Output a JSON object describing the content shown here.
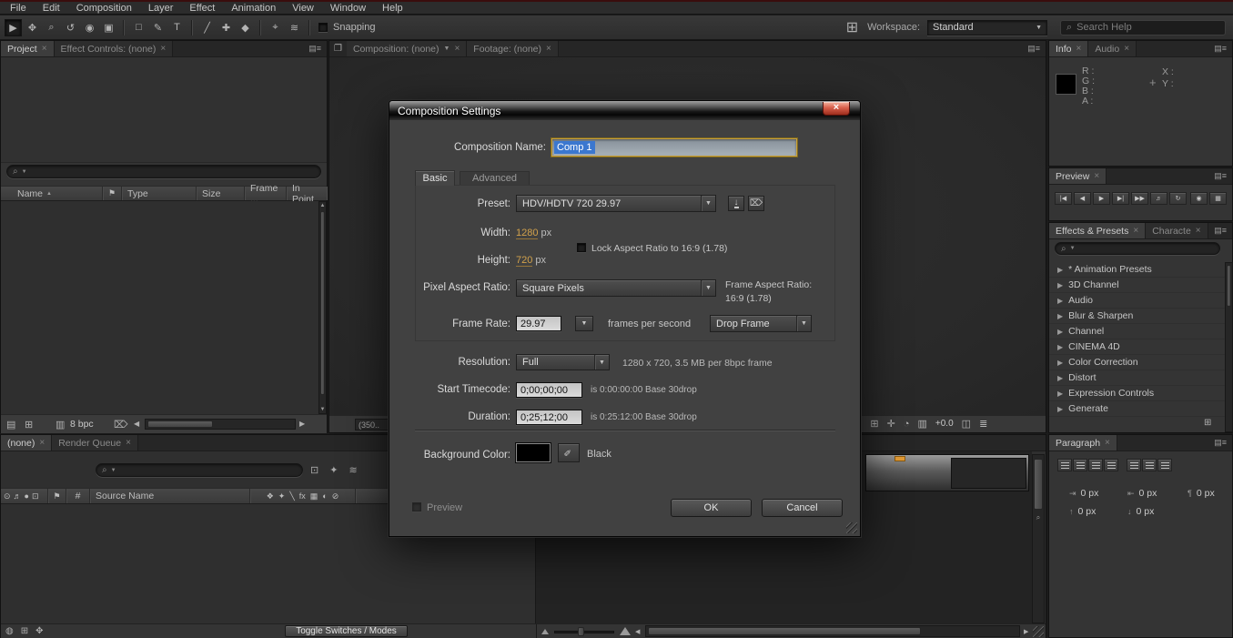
{
  "menubar": {
    "items": [
      "File",
      "Edit",
      "Composition",
      "Layer",
      "Effect",
      "Animation",
      "View",
      "Window",
      "Help"
    ]
  },
  "toolbar": {
    "snapping_label": "Snapping",
    "workspace_label": "Workspace:",
    "workspace_value": "Standard",
    "search_placeholder": "Search Help"
  },
  "project_panel": {
    "tab_project": "Project",
    "tab_effect_controls": "Effect Controls: (none)",
    "columns": [
      "Name",
      "Type",
      "Size",
      "Frame ...",
      "In Point"
    ],
    "bpc": "8 bpc"
  },
  "comp_panel": {
    "tab_composition": "Composition: (none)",
    "tab_footage": "Footage: (none)",
    "magnification": "(350..",
    "offset_value": "+0.0"
  },
  "info_panel": {
    "tab_info": "Info",
    "tab_audio": "Audio",
    "channel_labels": [
      "R :",
      "G :",
      "B :",
      "A :"
    ],
    "coord_labels": [
      "X :",
      "Y :"
    ]
  },
  "preview_panel": {
    "tab_preview": "Preview"
  },
  "effects_panel": {
    "tab_effects": "Effects & Presets",
    "tab_character": "Characte",
    "items": [
      "* Animation Presets",
      "3D Channel",
      "Audio",
      "Blur & Sharpen",
      "Channel",
      "CINEMA 4D",
      "Color Correction",
      "Distort",
      "Expression Controls",
      "Generate"
    ]
  },
  "paragraph_panel": {
    "tab_paragraph": "Paragraph",
    "values": [
      "0 px",
      "0 px",
      "0 px",
      "0 px",
      "0 px"
    ]
  },
  "timeline_panel": {
    "tab_none": "(none)",
    "tab_render_queue": "Render Queue",
    "column_hash": "#",
    "column_source_name": "Source Name",
    "toggle_button": "Toggle Switches / Modes"
  },
  "dialog": {
    "title": "Composition Settings",
    "name_label": "Composition Name:",
    "name_value": "Comp 1",
    "tab_basic": "Basic",
    "tab_advanced": "Advanced",
    "preset_label": "Preset:",
    "preset_value": "HDV/HDTV 720 29.97",
    "width_label": "Width:",
    "width_value": "1280",
    "width_unit": "px",
    "lock_aspect_label": "Lock Aspect Ratio to 16:9 (1.78)",
    "height_label": "Height:",
    "height_value": "720",
    "height_unit": "px",
    "par_label": "Pixel Aspect Ratio:",
    "par_value": "Square Pixels",
    "far_label": "Frame Aspect Ratio:",
    "far_value": "16:9 (1.78)",
    "frame_rate_label": "Frame Rate:",
    "frame_rate_value": "29.97",
    "fps_suffix": "frames per second",
    "drop_frame_value": "Drop Frame",
    "resolution_label": "Resolution:",
    "resolution_value": "Full",
    "resolution_info": "1280 x 720, 3.5 MB per 8bpc frame",
    "start_label": "Start Timecode:",
    "start_value": "0;00;00;00",
    "start_info": "is 0:00:00:00  Base 30drop",
    "duration_label": "Duration:",
    "duration_value": "0;25;12;00",
    "duration_info": "is 0:25:12:00  Base 30drop",
    "bg_label": "Background Color:",
    "bg_name": "Black",
    "preview_label": "Preview",
    "ok": "OK",
    "cancel": "Cancel"
  },
  "colors": {
    "hot_text": "#d2a24c",
    "selection_blue": "#3b77cf",
    "close_red": "#c14a33",
    "background_swatch": "#000000"
  }
}
